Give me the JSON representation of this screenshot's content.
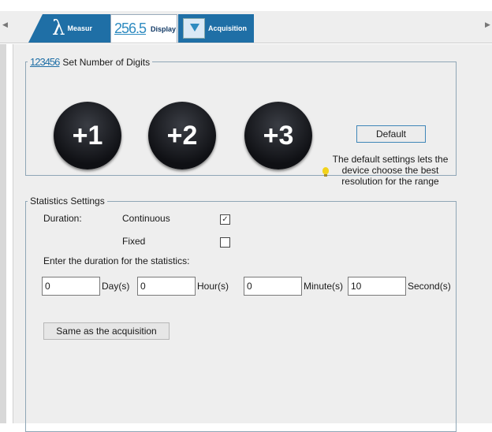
{
  "tabs": {
    "measure": {
      "label": "Measur",
      "icon": "lambda-icon",
      "glyph": "λ"
    },
    "display": {
      "label": "Display",
      "icon": "digits-icon",
      "glyph": "256.5"
    },
    "acquisition": {
      "label": "Acquisition",
      "icon": "acquisition-icon"
    }
  },
  "digits": {
    "legend_icon": "123456",
    "legend": "Set Number of Digits",
    "plus1": "+1",
    "plus2": "+2",
    "plus3": "+3",
    "default_label": "Default",
    "hint_lines": [
      "The default settings lets the",
      "device choose the best",
      "resolution for the range"
    ]
  },
  "stats": {
    "legend": "Statistics Settings",
    "duration_label": "Duration:",
    "continuous_label": "Continuous",
    "continuous_checked": true,
    "fixed_label": "Fixed",
    "fixed_checked": false,
    "check_mark": "✓",
    "instruction": "Enter the duration for the statistics:",
    "days": {
      "value": "0",
      "unit": "Day(s)"
    },
    "hours": {
      "value": "0",
      "unit": "Hour(s)"
    },
    "minutes": {
      "value": "0",
      "unit": "Minute(s)"
    },
    "seconds": {
      "value": "10",
      "unit": "Second(s)"
    },
    "same_button": "Same as the acquisition"
  },
  "colors": {
    "tab_blue": "#1f6fa6",
    "panel_bg": "#eeeeee",
    "button_border": "#3f86b8"
  }
}
